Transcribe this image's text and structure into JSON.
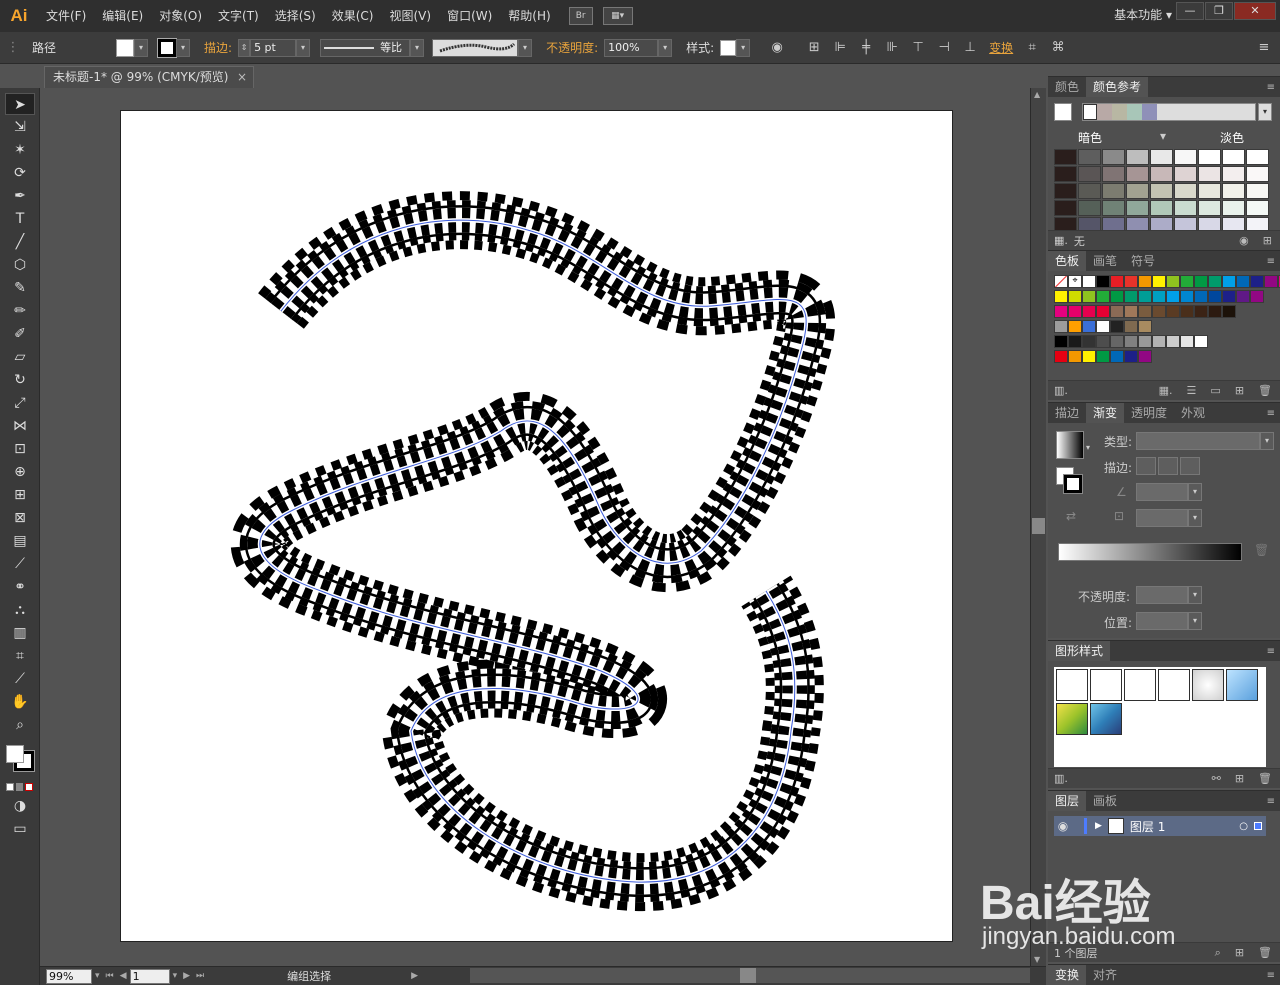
{
  "app": {
    "logo": "Ai",
    "workspace": "基本功能",
    "workspace_arrow": "▾"
  },
  "menu": [
    "文件(F)",
    "编辑(E)",
    "对象(O)",
    "文字(T)",
    "选择(S)",
    "效果(C)",
    "视图(V)",
    "窗口(W)",
    "帮助(H)"
  ],
  "menubar_buttons": {
    "bridge": "Br",
    "arrange": "▦▾"
  },
  "window_controls": {
    "minimize": "—",
    "restore": "❐",
    "close": "✕"
  },
  "control_bar": {
    "selection_type": "路径",
    "stroke_label": "描边:",
    "stroke_weight": "5 pt",
    "stroke_profile": "等比",
    "opacity_label": "不透明度:",
    "opacity_value": "100%",
    "style_label": "样式:",
    "transform_label": "变换"
  },
  "document_tab": {
    "title": "未标题-1* @ 99% (CMYK/预览)",
    "close": "×"
  },
  "status_bar": {
    "zoom": "99%",
    "artboard": "1",
    "tool_status": "编组选择"
  },
  "panels": {
    "color": {
      "tabs": [
        "颜色",
        "颜色参考"
      ],
      "shade_label": "暗色",
      "tint_label": "淡色",
      "none_label": "无"
    },
    "swatches": {
      "tabs": [
        "色板",
        "画笔",
        "符号"
      ]
    },
    "gradient": {
      "tabs": [
        "描边",
        "渐变",
        "透明度",
        "外观"
      ],
      "type_label": "类型:",
      "stroke_label": "描边:",
      "opacity_label": "不透明度:",
      "location_label": "位置:"
    },
    "graphic_styles": {
      "tabs": [
        "图形样式"
      ]
    },
    "layers": {
      "tabs": [
        "图层",
        "画板"
      ],
      "layer_name": "图层 1",
      "layer_count": "1 个图层"
    },
    "transform": {
      "tabs": [
        "变换",
        "对齐"
      ]
    }
  },
  "colors": {
    "color_guide_strip": [
      "#b8a9a6",
      "#b8b7a3",
      "#a8c6b8",
      "#8f90b8"
    ],
    "shade_grid": [
      [
        "#2a1e1c",
        "#5e5e5e",
        "#8a8a8a",
        "#bdbdbd",
        "#e8e8e8",
        "#f7f7f7",
        "#ffffff",
        "#ffffff",
        "#ffffff"
      ],
      [
        "#2a1e1c",
        "#5a5555",
        "#807474",
        "#a69595",
        "#c8b8b8",
        "#ded3d3",
        "#ebe4e4",
        "#f3eeee",
        "#faf8f8"
      ],
      [
        "#2a1e1c",
        "#5a5a55",
        "#7c7c70",
        "#a2a291",
        "#c3c3b2",
        "#d9d9cb",
        "#e7e7dd",
        "#f1f1ea",
        "#f8f8f5"
      ],
      [
        "#2a1e1c",
        "#556058",
        "#708276",
        "#90a89a",
        "#b0c8b8",
        "#cadcd0",
        "#dce8df",
        "#e9f2ec",
        "#f4f9f6"
      ],
      [
        "#2a1e1c",
        "#555568",
        "#6f6f8e",
        "#8f8fb0",
        "#acacc8",
        "#c5c5da",
        "#d8d8e7",
        "#e7e7f1",
        "#f3f3f8"
      ]
    ],
    "swatch_rows": [
      [
        "#ffffff",
        "#ffffff",
        "#ffffff",
        "#000000",
        "#e81e25",
        "#e8332a",
        "#f39800",
        "#fff100",
        "#8fc31f",
        "#22ac38",
        "#009944",
        "#009b6b",
        "#00a0e9",
        "#0068b7",
        "#1d2088",
        "#920783",
        "#e4007f"
      ],
      [
        "#fff100",
        "#cfdb00",
        "#8fc31f",
        "#22ac38",
        "#009944",
        "#009b6b",
        "#009e96",
        "#00a0c1",
        "#00a0e9",
        "#0086d1",
        "#0068b7",
        "#00479d",
        "#1d2088",
        "#601986",
        "#920783"
      ],
      [
        "#e4007f",
        "#e5006a",
        "#e5004f",
        "#e60033",
        "#8b6a56",
        "#a0785a",
        "#7a5c3f",
        "#6a4a2f",
        "#5a3b23",
        "#4a2f1b",
        "#3b2315",
        "#2c1a10",
        "#1c1209"
      ],
      [
        "#9c9c9c",
        "#ff9f00",
        "#3a6fd8",
        "#ffffff",
        "#222222",
        "#7f6a50",
        "#a88b60"
      ],
      [
        "#000000",
        "#1a1a1a",
        "#333333",
        "#4d4d4d",
        "#666666",
        "#808080",
        "#999999",
        "#b3b3b3",
        "#cccccc",
        "#e6e6e6",
        "#ffffff"
      ],
      [
        "#e60012",
        "#f39800",
        "#fff100",
        "#009944",
        "#0068b7",
        "#1d2088",
        "#920783"
      ]
    ],
    "graphic_style_tiles": [
      "#ffffff",
      "#ffffff",
      "#ffffff",
      "#ffffff",
      "#cfcfcf",
      "#5aa0dd",
      "#9cc32a",
      "#2f7fb8"
    ]
  },
  "watermark": {
    "brand": "Bai经验",
    "domain": "jingyan.baidu.com"
  }
}
